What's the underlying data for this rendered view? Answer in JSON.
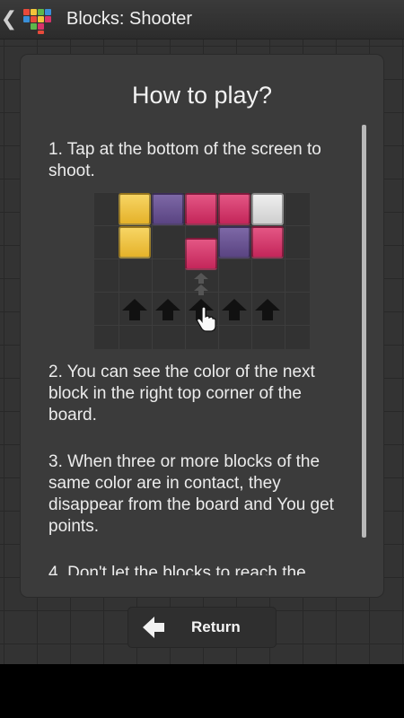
{
  "actionbar": {
    "title": "Blocks: Shooter",
    "back_glyph": "❮",
    "icon": "app-blocks-icon"
  },
  "dialog": {
    "title": "How to play?",
    "instructions": [
      "1. Tap at the bottom of the screen to shoot.",
      "2. You can see the color of the next block in the right top corner of the board.",
      "3. When three or more blocks of the same color are in contact, they disappear from the board and You get points.",
      "4. Don't let the blocks to reach the"
    ],
    "illustration": {
      "icon": "board-illustration",
      "colors": {
        "yellow": "#f2c53a",
        "purple": "#6b5494",
        "pink": "#d8336a",
        "white": "#e0e0e0"
      }
    }
  },
  "return_button": {
    "label": "Return",
    "icon": "arrow-left-icon"
  }
}
